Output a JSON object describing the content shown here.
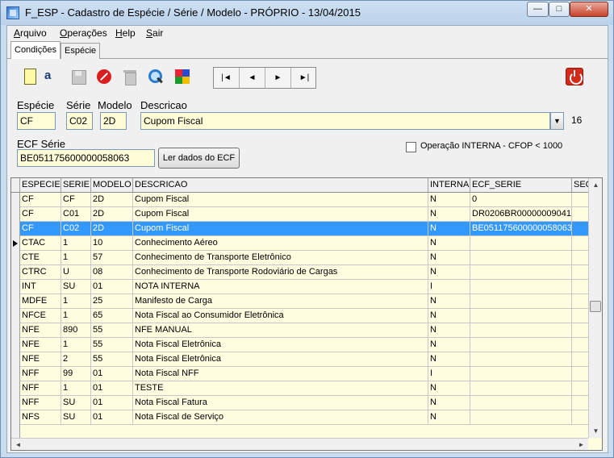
{
  "window": {
    "title": "F_ESP - Cadastro de Espécie / Série / Modelo - PRÓPRIO - 13/04/2015"
  },
  "menu": [
    {
      "first": "A",
      "rest": "rquivo"
    },
    {
      "first": "O",
      "rest": "perações"
    },
    {
      "first": "H",
      "rest": "elp"
    },
    {
      "first": "S",
      "rest": "air"
    }
  ],
  "tabs": [
    "Condições",
    "Espécie"
  ],
  "toolbar": {
    "spell_glyph": "a",
    "nav": [
      "|◄",
      "◄",
      "►",
      "►|"
    ]
  },
  "form": {
    "especie_label": "Espécie",
    "serie_label": "Série",
    "modelo_label": "Modelo",
    "descricao_label": "Descricao",
    "especie_value": "CF",
    "serie_value": "C02",
    "modelo_value": "2D",
    "descricao_value": "Cupom Fiscal",
    "count": "16",
    "ecf_label": "ECF Série",
    "ecf_value": "BE051175600000058063",
    "ler_button": "Ler dados do ECF",
    "checkbox_label": "Operação INTERNA - CFOP < 1000"
  },
  "grid": {
    "columns": [
      "ESPECIE",
      "SERIE",
      "MODELO",
      "DESCRICAO",
      "INTERNA",
      "ECF_SERIE",
      "SEQ"
    ],
    "rows": [
      [
        "CF",
        "CF",
        "2D",
        "Cupom Fiscal",
        "N",
        "0"
      ],
      [
        "CF",
        "C01",
        "2D",
        "Cupom Fiscal",
        "N",
        "DR0206BR00000009041"
      ],
      [
        "CF",
        "C02",
        "2D",
        "Cupom Fiscal",
        "N",
        "BE051175600000058063"
      ],
      [
        "CTAC",
        "1",
        "10",
        "Conhecimento Aéreo",
        "N",
        ""
      ],
      [
        "CTE",
        "1",
        "57",
        "Conhecimento de Transporte Eletrônico",
        "N",
        ""
      ],
      [
        "CTRC",
        "U",
        "08",
        "Conhecimento de Transporte Rodoviário de Cargas",
        "N",
        ""
      ],
      [
        "INT",
        "SU",
        "01",
        "NOTA INTERNA",
        "I",
        ""
      ],
      [
        "MDFE",
        "1",
        "25",
        "Manifesto de Carga",
        "N",
        ""
      ],
      [
        "NFCE",
        "1",
        "65",
        "Nota Fiscal ao Consumidor Eletrônica",
        "N",
        ""
      ],
      [
        "NFE",
        "890",
        "55",
        "NFE MANUAL",
        "N",
        ""
      ],
      [
        "NFE",
        "1",
        "55",
        "Nota Fiscal Eletrônica",
        "N",
        ""
      ],
      [
        "NFE",
        "2",
        "55",
        "Nota Fiscal Eletrônica",
        "N",
        ""
      ],
      [
        "NFF",
        "99",
        "01",
        "Nota Fiscal   NFF",
        "I",
        ""
      ],
      [
        "NFF",
        "1",
        "01",
        "TESTE",
        "N",
        ""
      ],
      [
        "NFF",
        "SU",
        "01",
        "Nota Fiscal Fatura",
        "N",
        ""
      ],
      [
        "NFS",
        "SU",
        "01",
        "Nota Fiscal de Serviço",
        "N",
        ""
      ]
    ],
    "selected_row": 2
  },
  "scroll": {
    "up": "▲",
    "down": "▼",
    "left": "◄",
    "right": "►"
  }
}
